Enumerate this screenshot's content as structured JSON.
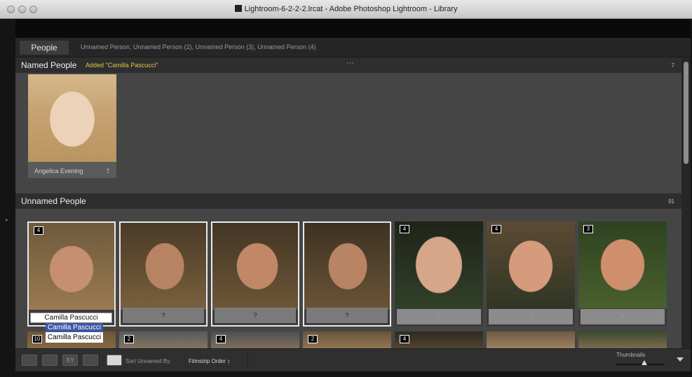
{
  "window": {
    "title": "Lightroom-6-2-2-2.lrcat - Adobe Photoshop Lightroom - Library"
  },
  "people_bar": {
    "tab_label": "People",
    "unnamed_list": "Unnamed Person,  Unnamed Person (2),  Unnamed Person (3),  Unnamed Person (4)"
  },
  "named_people": {
    "title": "Named People",
    "added_message": "Added \"Camilla Pascucci\"",
    "count": "7",
    "dots": "···",
    "people": [
      {
        "name": "Angelica Evening",
        "count": "7"
      }
    ]
  },
  "unnamed_people": {
    "title": "Unnamed People",
    "count": "91",
    "cards": [
      {
        "badge": "4",
        "label": "?",
        "selected": true
      },
      {
        "badge": "",
        "label": "?",
        "selected": true
      },
      {
        "badge": "",
        "label": "?",
        "selected": true
      },
      {
        "badge": "",
        "label": "?",
        "selected": true
      },
      {
        "badge": "4",
        "label": "?",
        "selected": false
      },
      {
        "badge": "4",
        "label": "?",
        "selected": false
      },
      {
        "badge": "3",
        "label": "?",
        "selected": false
      }
    ],
    "second_row_badges": [
      "10",
      "2",
      "4",
      "2",
      "4",
      "",
      ""
    ]
  },
  "name_entry": {
    "input_value": "Camilla Pascucci",
    "suggestions": [
      "Camilla Pascucci",
      "Camilla Pascucci"
    ]
  },
  "toolbar": {
    "sort_label": "Sort Unnamed By:",
    "sort_value": "Filmstrip Order ↕",
    "thumbnails_label": "Thumbnails",
    "thumbnail_size": 0.55
  },
  "colors": {
    "accent_yellow": "#e5c347",
    "selection_blue": "#3c57a4"
  }
}
